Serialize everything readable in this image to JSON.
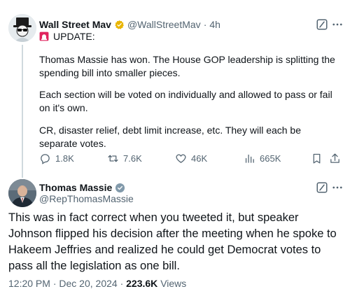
{
  "parent_tweet": {
    "display_name": "Wall Street Mav",
    "handle": "@WallStreetMav",
    "separator": "·",
    "age": "4h",
    "update_label": "UPDATE:",
    "paragraphs": [
      "Thomas Massie has won. The House GOP leadership is splitting the spending bill into smaller pieces.",
      "Each section will be voted on individually and allowed to pass or fail on it's own.",
      "CR, disaster relief, debt limit increase, etc. They will each be separate votes."
    ],
    "metrics": {
      "replies": "1.8K",
      "reposts": "7.6K",
      "likes": "46K",
      "views": "665K"
    },
    "icons": {
      "avatar": "avatar",
      "verified": "verified-badge-icon",
      "grok": "grok-icon",
      "more": "more-icon",
      "siren": "siren-icon",
      "reply": "reply-icon",
      "repost": "repost-icon",
      "like": "like-icon",
      "views": "views-icon",
      "bookmark": "bookmark-icon",
      "share": "share-icon"
    }
  },
  "main_tweet": {
    "display_name": "Thomas Massie",
    "handle": "@RepThomasMassie",
    "text": "This was in fact correct when you tweeted it, but speaker Johnson flipped his decision after the meeting when he spoke to Hakeem Jeffries and realized he could get Democrat votes to pass all the legislation as one bill.",
    "time": "12:20 PM",
    "separator": "·",
    "date": "Dec 20, 2024",
    "views_count": "223.6K",
    "views_label": "Views"
  },
  "colors": {
    "text": "#0f1419",
    "secondary": "#536471",
    "verified": "#e9b500",
    "thread_line": "#cfd9de",
    "siren": "#e0245e"
  }
}
